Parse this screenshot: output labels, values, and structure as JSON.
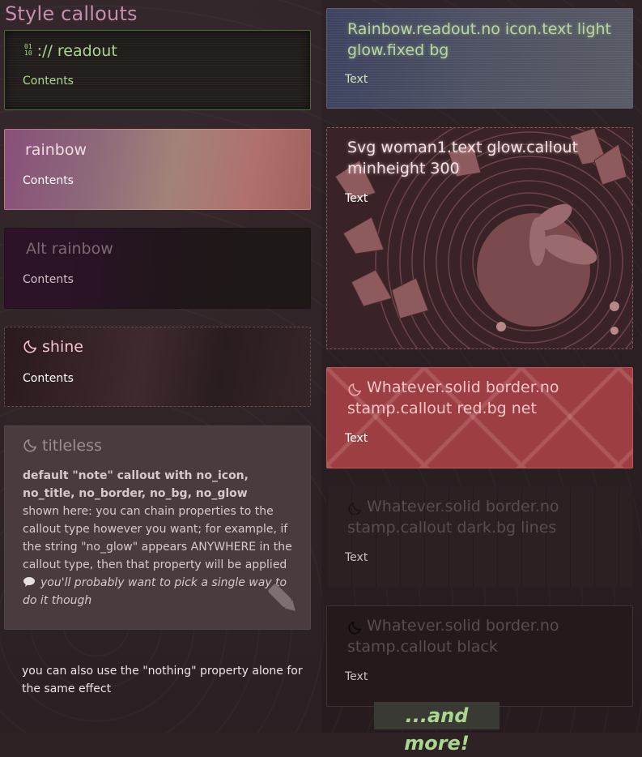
{
  "page": {
    "heading": "Style callouts"
  },
  "left": {
    "readout": {
      "title": ":// readout",
      "icon": "binary-icon",
      "body": "Contents"
    },
    "rainbow": {
      "title": "rainbow",
      "body": "Contents"
    },
    "alt_rainbow": {
      "title": "Alt rainbow",
      "body": "Contents"
    },
    "shine": {
      "title": "shine",
      "icon": "moon-icon",
      "body": "Contents"
    },
    "titleless": {
      "title": "titleless",
      "icon": "moon-icon",
      "bold_line": "default \"note\" callout with no_icon, no_title, no_border, no_bg, no_glow",
      "text": "shown here: you can chain properties to the callout type however you want; for example, if the string \"no_glow\" appears ANYWHERE in the callout type, then that property will be applied",
      "italic_line": "you'll probably want to pick a single way to do it though",
      "speech_icon": "speech-bubble-icon",
      "pencil_icon": "pencil-icon"
    },
    "footnote": "you can also use the \"nothing\" property alone for the same effect"
  },
  "right": {
    "rainbow_readout": {
      "title": "Rainbow.readout.no icon.text light glow.fixed bg",
      "body": "Text"
    },
    "svg_woman": {
      "title": "Svg woman1.text glow.callout minheight 300",
      "body": "Text"
    },
    "red": {
      "title": "Whatever.solid border.no stamp.callout red.bg net",
      "icon": "moon-icon",
      "body": "Text"
    },
    "dark": {
      "title": "Whatever.solid border.no stamp.callout dark.bg lines",
      "icon": "moon-icon",
      "body": "Text"
    },
    "black": {
      "title": "Whatever.solid border.no stamp.callout black",
      "icon": "moon-icon",
      "body": "Text"
    }
  },
  "footer": {
    "and_more": "...and more!"
  },
  "colors": {
    "heading": "#c48fae",
    "readout_green": "#a9d78f",
    "red_bg": "#9c3e42"
  }
}
